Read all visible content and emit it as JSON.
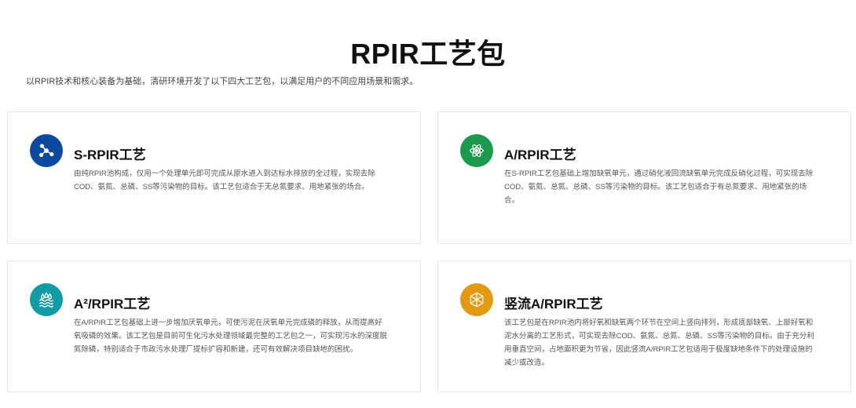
{
  "header": {
    "title": "RPIR工艺包",
    "subtitle": "以RPIR技术和核心装备为基础，清研环境开发了以下四大工艺包，以满足用户的不同应用场景和需求。"
  },
  "cards": [
    {
      "title": "S-RPIR工艺",
      "description": "由纯RPIR池构成，仅用一个处理单元即可完成从原水进入到达标水排放的全过程，实现去除COD、氨氮、总磷、SS等污染物的目标。该工艺包适合于无总氮要求、用地紧张的场合。",
      "icon": "molecule-icon",
      "color": "#0b4a9e"
    },
    {
      "title": "A/RPIR工艺",
      "description": "在S-RPIR工艺包基础上增加缺氧单元，通过硝化液回流缺氧单元完成反硝化过程，可实现去除COD、氨氮、总氮、总磷、SS等污染物的目标。该工艺包适合于有总氮要求、用地紧张的场合。",
      "icon": "atom-icon",
      "color": "#1a9b4b"
    },
    {
      "title": "A²/RPIR工艺",
      "description": "在A/RPIR工艺包基础上进一步增加厌氧单元，可使污泥在厌氧单元完成磷的释放，从而提高好氧吸磷的效果。该工艺包是目前可生化污水处理领域最完整的工艺包之一，可实现污水的深度脱氮除磷，特别适合于市政污水处理厂提标扩容和新建，还可有效解决项目缺地的困扰。",
      "icon": "water-icon",
      "color": "#119ba6"
    },
    {
      "title": "竖流A/RPIR工艺",
      "description": "该工艺包是在RPIR池内将好氧和缺氧两个环节在空间上竖向排列，形成底部缺氧、上部好氧和泥水分离的工艺形式，可实现去除COD、氨氮、总氮、总磷、SS等污染物的目标。由于充分利用垂直空间，占地面积更为节省，因此竖流A/RPIR工艺包适用于极度缺地条件下的处理设施的减少或改造。",
      "icon": "cube-icon",
      "color": "#e39a12"
    }
  ]
}
